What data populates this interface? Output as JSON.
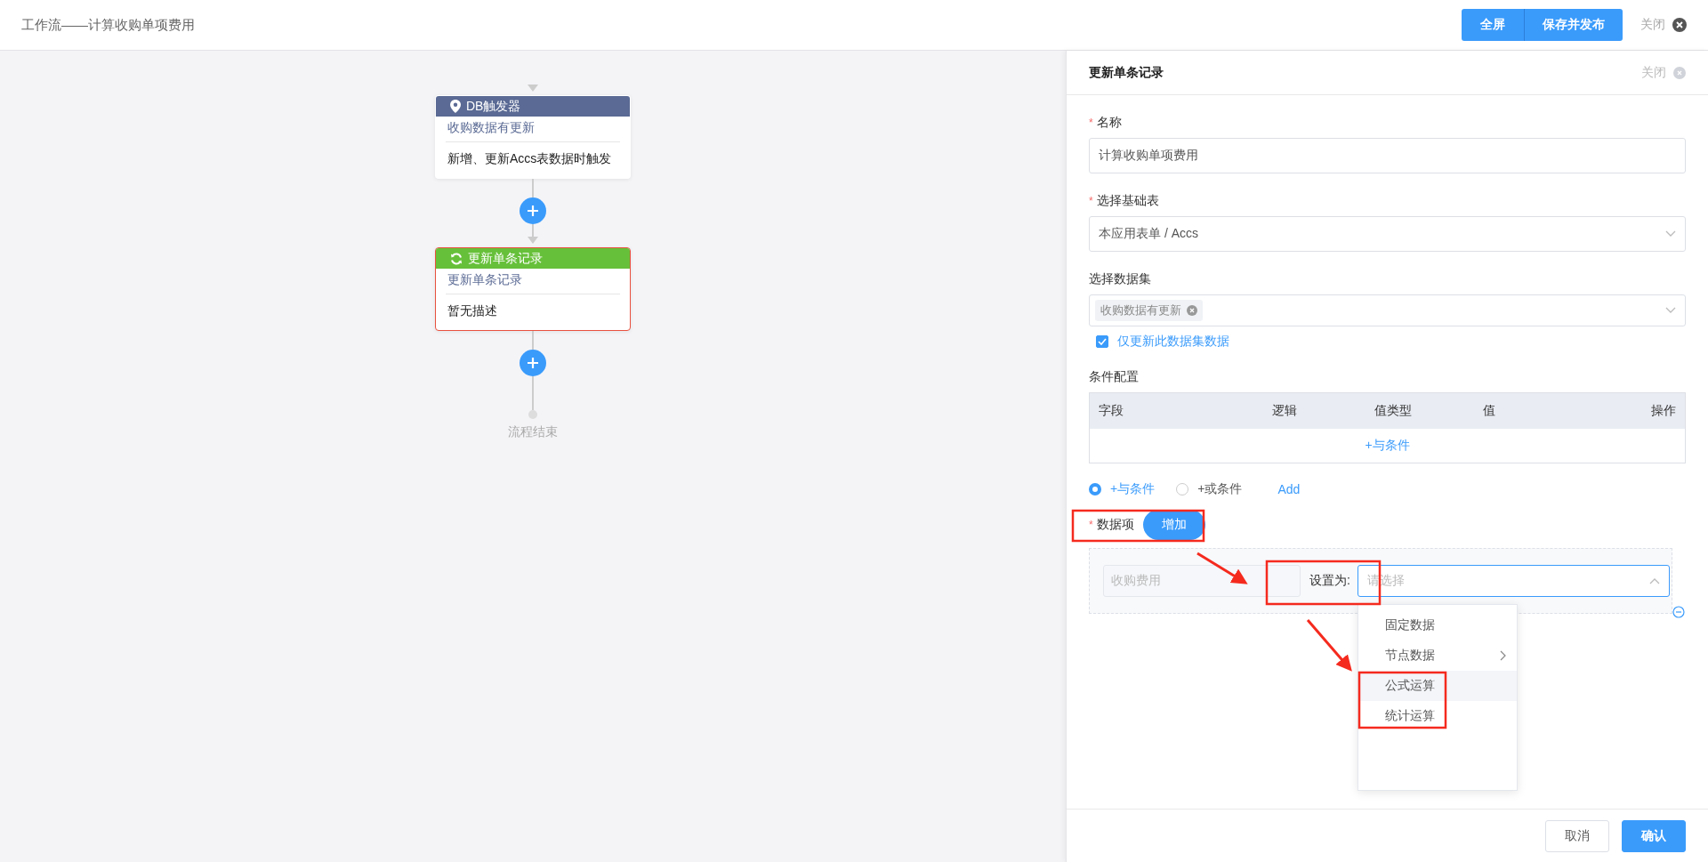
{
  "header": {
    "title": "工作流——计算收购单项费用",
    "buttons": [
      "全屏",
      "保存并发布"
    ],
    "close": "关闭"
  },
  "flow": {
    "nodes": [
      {
        "kind": "trigger",
        "title": "DB触发器",
        "name": "收购数据有更新",
        "description": "新增、更新Accs表数据时触发",
        "selected": false
      },
      {
        "kind": "update",
        "title": "更新单条记录",
        "name": "更新单条记录",
        "description": "暂无描述",
        "selected": true
      }
    ],
    "end": "流程结束"
  },
  "panel": {
    "title": "更新单条记录",
    "close": "关闭",
    "name_field": {
      "required_mark": "*",
      "label": "名称",
      "value": "计算收购单项费用"
    },
    "table_field": {
      "required_mark": "*",
      "label": "选择基础表",
      "value": "本应用表单 / Accs"
    },
    "dataset_field": {
      "label": "选择数据集",
      "tag": "收购数据有更新"
    },
    "only_dataset": {
      "label": "仅更新此数据集数据",
      "checked": true
    },
    "conditions": {
      "label": "条件配置",
      "columns": [
        "字段",
        "逻辑",
        "值类型",
        "值",
        "操作"
      ],
      "add_link": "+与条件"
    },
    "logic": [
      {
        "label": "+与条件",
        "selected": true
      },
      {
        "label": "+或条件",
        "selected": false
      }
    ],
    "add_link": "Add",
    "data_items": {
      "required_mark": "*",
      "label": "数据项",
      "add_button": "增加",
      "rows": [
        {
          "field": "收购费用",
          "set_label": "设置为:",
          "placeholder": "请选择",
          "open": true
        }
      ]
    },
    "dropdown": [
      {
        "label": "固定数据",
        "submenu": false,
        "highlighted": false
      },
      {
        "label": "节点数据",
        "submenu": true,
        "highlighted": false
      },
      {
        "label": "公式运算",
        "submenu": false,
        "highlighted": true
      },
      {
        "label": "统计运算",
        "submenu": false,
        "highlighted": false
      }
    ],
    "footer": {
      "cancel": "取消",
      "confirm": "确认"
    }
  }
}
